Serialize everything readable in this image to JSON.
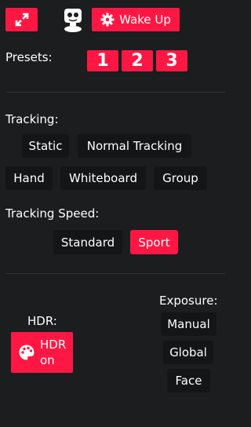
{
  "toolbar": {
    "expand_icon": "expand-arrows-icon",
    "camera_icon": "robot-camera-icon",
    "wake_icon": "gear-icon",
    "wake_label": "Wake Up"
  },
  "presets": {
    "label": "Presets:",
    "items": [
      "1",
      "2",
      "3"
    ]
  },
  "tracking": {
    "label": "Tracking:",
    "modes": [
      "Static",
      "Normal Tracking",
      "Hand",
      "Whiteboard",
      "Group"
    ]
  },
  "tracking_speed": {
    "label": "Tracking Speed:",
    "options": [
      "Standard",
      "Sport"
    ],
    "selected": "Sport"
  },
  "hdr": {
    "label": "HDR:",
    "button_label_line1": "HDR",
    "button_label_line2": "on",
    "icon": "palette-icon"
  },
  "exposure": {
    "label": "Exposure:",
    "options": [
      "Manual",
      "Global",
      "Face"
    ]
  },
  "colors": {
    "accent": "#ff1744",
    "background": "#1c1d1f",
    "button_dark": "#141516"
  }
}
